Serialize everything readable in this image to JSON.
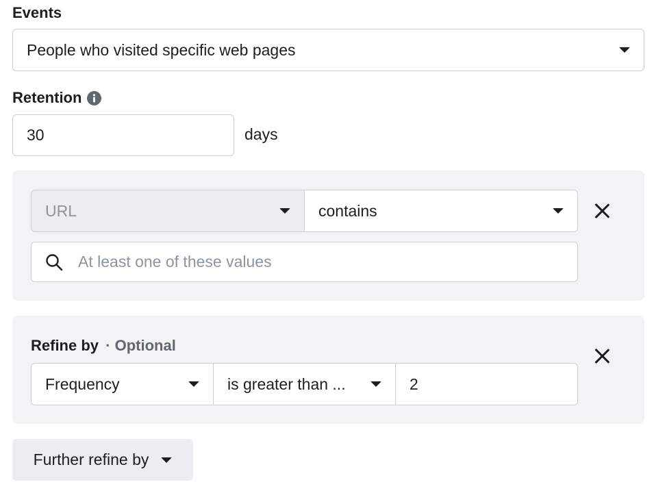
{
  "events": {
    "label": "Events",
    "selected": "People who visited specific web pages"
  },
  "retention": {
    "label": "Retention",
    "value": "30",
    "unit": "days",
    "info_icon": "info-icon"
  },
  "rule": {
    "field": "URL",
    "operator": "contains",
    "search_placeholder": "At least one of these values",
    "search_icon": "search-icon",
    "remove_icon": "close-icon"
  },
  "refine": {
    "label": "Refine by",
    "optional": "· Optional",
    "field": "Frequency",
    "operator": "is greater than ...",
    "value": "2",
    "remove_icon": "close-icon"
  },
  "further": {
    "label": "Further refine by"
  }
}
